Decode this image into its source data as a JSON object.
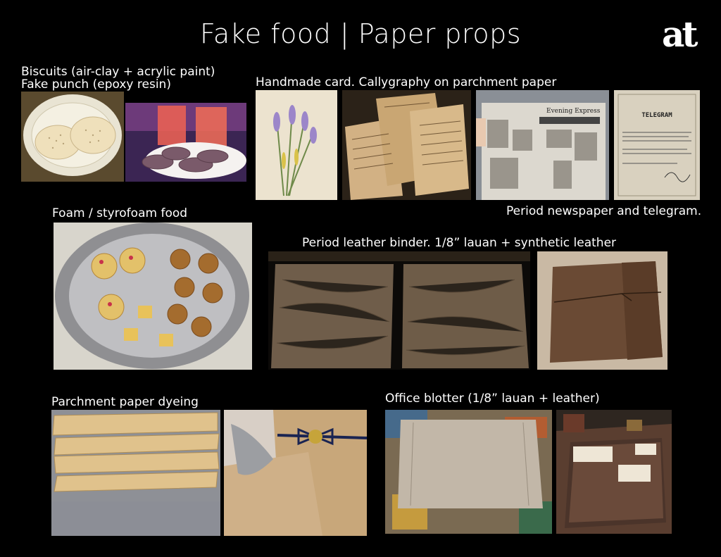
{
  "page": {
    "title": "Fake food | Paper props",
    "logo_text": "at"
  },
  "captions": {
    "biscuits": "Biscuits (air-clay + acrylic paint)",
    "punch": "Fake punch (epoxy resin)",
    "card": "Handmade card. Callygraphy on parchment paper",
    "newspaper": "Period newspaper and telegram.",
    "foam": "Foam / styrofoam food",
    "binder": "Period leather binder. 1/8” lauan + synthetic leather",
    "dyeing": "Parchment paper dyeing",
    "blotter": "Office blotter (1/8” lauan + leather)"
  },
  "photo_text": {
    "newspaper_masthead": "Evening Express",
    "telegram_heading": "TELEGRAM"
  }
}
